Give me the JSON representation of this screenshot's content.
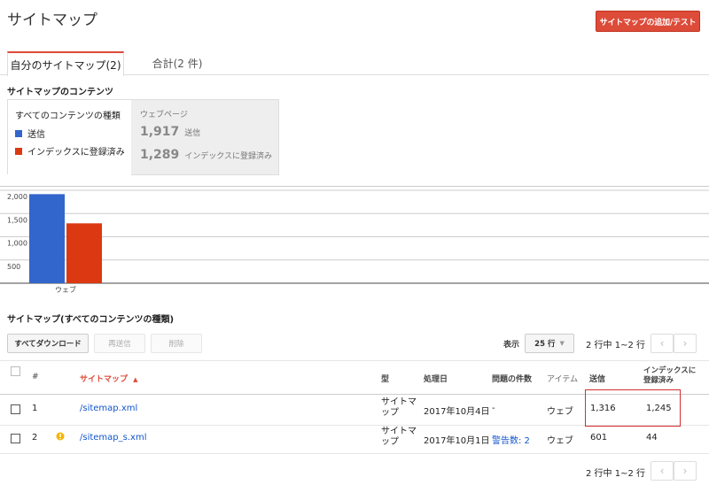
{
  "header": {
    "title": "サイトマップ",
    "add_button": "サイトマップの追加/テスト"
  },
  "tabs": [
    {
      "label": "自分のサイトマップ(2)"
    },
    {
      "label": "合計(2 件)"
    }
  ],
  "contents_section": {
    "title": "サイトマップのコンテンツ",
    "legend": {
      "heading": "すべてのコンテンツの種類",
      "submitted": "送信",
      "indexed": "インデックスに登録済み"
    },
    "stats": {
      "label": "ウェブページ",
      "submitted_value": "1,917",
      "submitted_label": "送信",
      "indexed_value": "1,289",
      "indexed_label": "インデックスに登録済み"
    }
  },
  "colors": {
    "submitted": "#3366cc",
    "indexed": "#dc3912",
    "accent": "#dd4b39"
  },
  "chart_data": {
    "type": "bar",
    "categories": [
      "ウェブ"
    ],
    "series": [
      {
        "name": "送信",
        "values": [
          1917
        ]
      },
      {
        "name": "インデックスに登録済み",
        "values": [
          1289
        ]
      }
    ],
    "yticks": [
      "2,000",
      "1,500",
      "1,000",
      "500"
    ],
    "ytick_values": [
      2000,
      1500,
      1000,
      500
    ],
    "ylim": [
      0,
      2000
    ]
  },
  "list_section": {
    "title": "サイトマップ(すべてのコンテンツの種類)"
  },
  "toolbar": {
    "download": "すべてダウンロード",
    "resubmit": "再送信",
    "delete": "削除",
    "show_label": "表示",
    "rows_select": "25 行",
    "pagination": "2 行中 1~2 行"
  },
  "table": {
    "headers": {
      "num": "#",
      "sitemap": "サイトマップ",
      "type": "型",
      "processed": "処理日",
      "issues": "問題の件数",
      "items": "アイテム",
      "submitted": "送信",
      "indexed": "インデックスに登録済み"
    },
    "rows": [
      {
        "num": "1",
        "sitemap": "/sitemap.xml",
        "type": "サイトマップ",
        "processed": "2017年10月4日",
        "issues": "-",
        "items": "ウェブ",
        "submitted": "1,316",
        "indexed": "1,245"
      },
      {
        "num": "2",
        "sitemap": "/sitemap_s.xml",
        "type": "サイトマップ",
        "processed": "2017年10月1日",
        "issues": "警告数: 2",
        "items": "ウェブ",
        "submitted": "601",
        "indexed": "44"
      }
    ]
  }
}
